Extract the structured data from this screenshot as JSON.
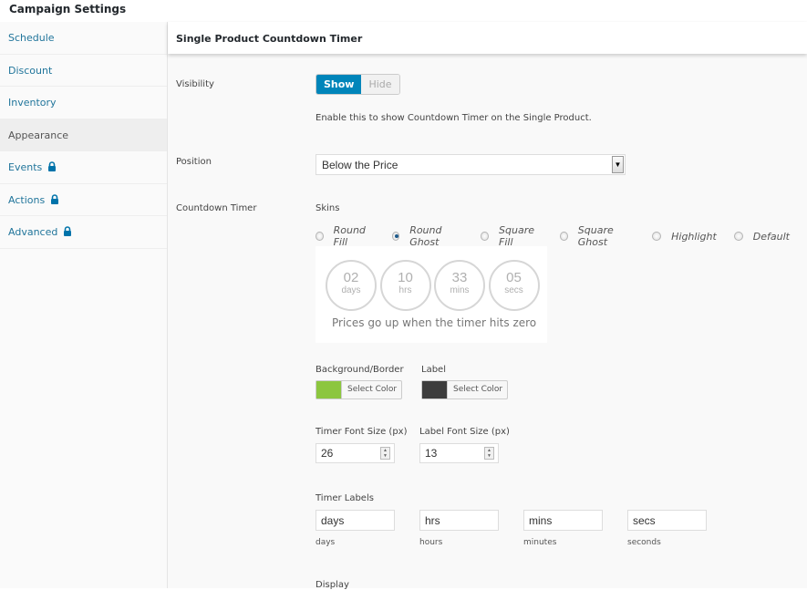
{
  "page": {
    "title": "Campaign Settings"
  },
  "sidebar": {
    "items": [
      {
        "label": "Schedule",
        "locked": false,
        "active": false
      },
      {
        "label": "Discount",
        "locked": false,
        "active": false
      },
      {
        "label": "Inventory",
        "locked": false,
        "active": false
      },
      {
        "label": "Appearance",
        "locked": false,
        "active": true
      },
      {
        "label": "Events",
        "locked": true,
        "active": false
      },
      {
        "label": "Actions",
        "locked": true,
        "active": false
      },
      {
        "label": "Advanced",
        "locked": true,
        "active": false
      }
    ],
    "lock_icon": "lock-icon"
  },
  "panel": {
    "title": "Single Product Countdown Timer",
    "visibility": {
      "label": "Visibility",
      "options": [
        "Show",
        "Hide"
      ],
      "selected": "Show",
      "description": "Enable this to show Countdown Timer on the Single Product."
    },
    "position": {
      "label": "Position",
      "value": "Below the Price"
    },
    "countdown": {
      "label": "Countdown Timer",
      "skins_label": "Skins",
      "skins": [
        "Round Fill",
        "Round Ghost",
        "Square Fill",
        "Square Ghost",
        "Highlight",
        "Default"
      ],
      "selected_skin": "Round Ghost",
      "preview": {
        "units": [
          {
            "value": "02",
            "label": "days"
          },
          {
            "value": "10",
            "label": "hrs"
          },
          {
            "value": "33",
            "label": "mins"
          },
          {
            "value": "05",
            "label": "secs"
          }
        ],
        "message": "Prices go up when the timer hits zero"
      },
      "colors": {
        "bg_label": "Background/Border",
        "bg_color": "#8cc63f",
        "label_label": "Label",
        "label_color": "#3d3d3d",
        "button_text": "Select Color"
      },
      "font_sizes": {
        "timer_label": "Timer Font Size (px)",
        "timer_value": "26",
        "label_label": "Label Font Size (px)",
        "label_value": "13"
      },
      "timer_labels": {
        "heading": "Timer Labels",
        "fields": [
          {
            "value": "days",
            "caption": "days"
          },
          {
            "value": "hrs",
            "caption": "hours"
          },
          {
            "value": "mins",
            "caption": "minutes"
          },
          {
            "value": "secs",
            "caption": "seconds"
          }
        ]
      },
      "display_label": "Display"
    }
  }
}
